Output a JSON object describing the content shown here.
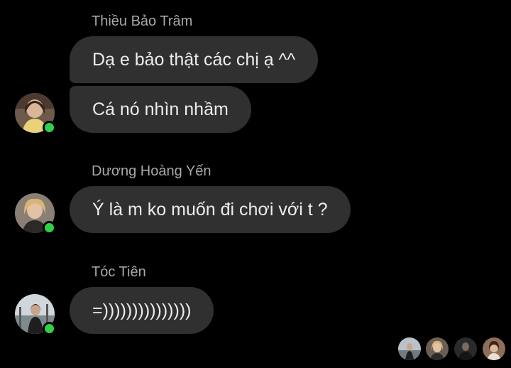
{
  "messages": [
    {
      "sender": "Thiều Bảo Trâm",
      "bubbles": [
        "Dạ e bảo thật các chị ạ ^^",
        "Cá nó nhìn nhầm"
      ],
      "avatar": "profile-photo-woman-yellow-top",
      "online": true
    },
    {
      "sender": "Dương Hoàng Yến",
      "bubbles": [
        "Ý là m ko muốn đi chơi với t ?"
      ],
      "avatar": "profile-photo-woman-blonde",
      "online": true
    },
    {
      "sender": "Tóc Tiên",
      "bubbles": [
        "=)))))))))))))))"
      ],
      "avatar": "profile-photo-woman-outdoor",
      "online": true
    }
  ],
  "read_receipts": {
    "avatars": [
      "seen-avatar-1",
      "seen-avatar-2",
      "seen-avatar-3",
      "seen-avatar-4"
    ]
  },
  "colors": {
    "background": "#000000",
    "bubble": "#303030",
    "bubble_text": "#ececec",
    "sender_text": "#a8a8a8",
    "online_dot": "#2fd14a"
  }
}
